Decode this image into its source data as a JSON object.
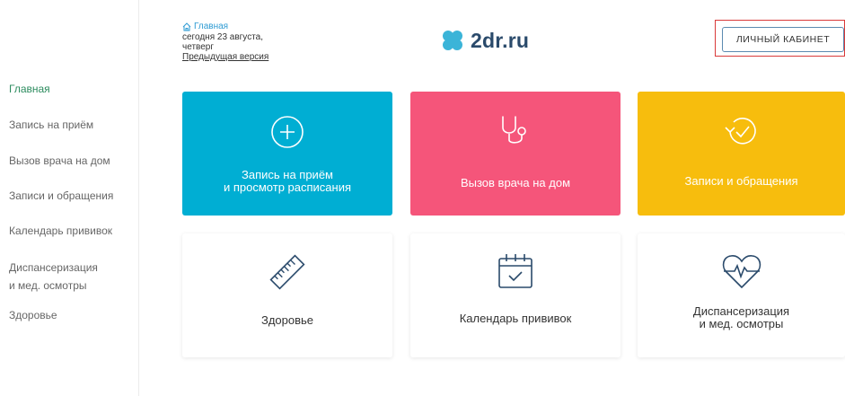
{
  "sidebar": {
    "items": [
      {
        "label": "Главная",
        "active": true
      },
      {
        "label": "Запись на приём"
      },
      {
        "label": "Вызов врача на дом"
      },
      {
        "label": "Записи и обращения"
      },
      {
        "label": "Календарь прививок"
      },
      {
        "label": "Диспансеризация\nи мед. осмотры"
      },
      {
        "label": "Здоровье"
      }
    ]
  },
  "header": {
    "breadcrumb_home": "Главная",
    "date_text": "сегодня 23 августа, четверг",
    "prev_version": "Предыдущая версия",
    "logo_text": "2dr.ru",
    "cabinet_button": "ЛИЧНЫЙ КАБИНЕТ"
  },
  "tiles": [
    {
      "label": "Запись на приём\nи просмотр расписания",
      "color": "#00aed3",
      "icon": "plus-circle-icon"
    },
    {
      "label": "Вызов врача на дом",
      "color": "#f5557a",
      "icon": "stethoscope-icon"
    },
    {
      "label": "Записи и обращения",
      "color": "#f7bd0d",
      "icon": "history-check-icon"
    },
    {
      "label": "Здоровье",
      "color": "#ffffff",
      "icon": "ruler-icon"
    },
    {
      "label": "Календарь прививок",
      "color": "#ffffff",
      "icon": "calendar-check-icon"
    },
    {
      "label": "Диспансеризация\nи мед. осмотры",
      "color": "#ffffff",
      "icon": "heart-pulse-icon"
    }
  ],
  "colors": {
    "accent_green": "#2d8c5f",
    "logo_blue": "#2a4a6b",
    "logo_clover": "#3bb4d8"
  }
}
